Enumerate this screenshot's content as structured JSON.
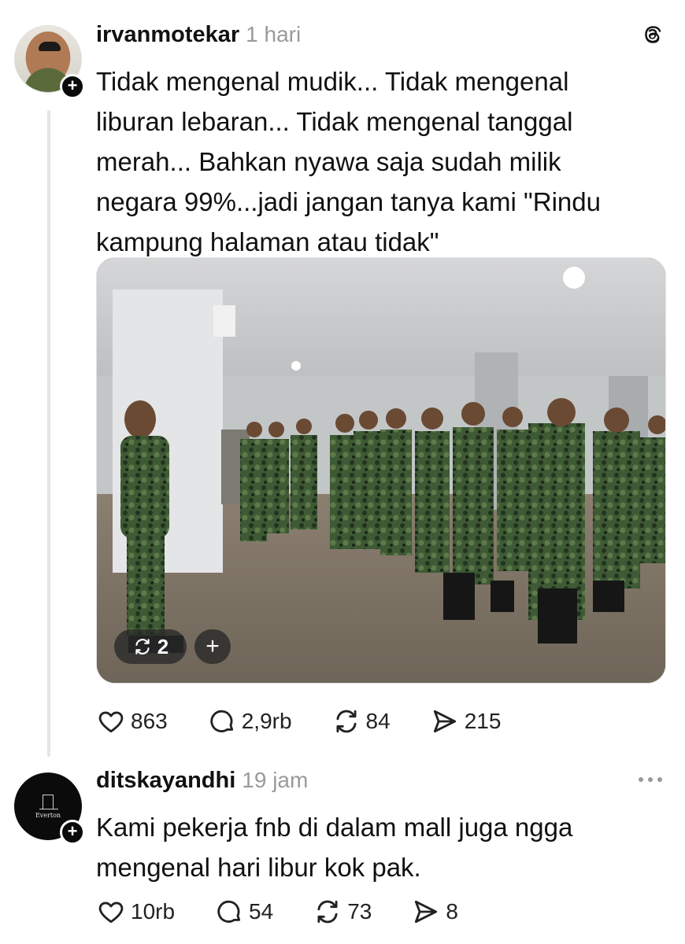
{
  "posts": [
    {
      "username": "irvanmotekar",
      "time": "1 hari",
      "text": "Tidak mengenal mudik... Tidak mengenal\nliburan lebaran... Tidak mengenal tanggal\nmerah... Bahkan nyawa saja sudah milik\nnegara 99%...jadi jangan tanya kami \"Rindu\nkampung halaman atau tidak\"",
      "image_overlay": {
        "repost_count": "2",
        "add_icon": "plus-icon"
      },
      "likes": "863",
      "replies": "2,9rb",
      "reposts": "84",
      "shares": "215"
    },
    {
      "username": "ditskayandhi",
      "time": "19 jam",
      "avatar_logo_text": "Everton",
      "text": "Kami pekerja fnb di dalam mall juga ngga\nmengenal hari libur kok pak.",
      "likes": "10rb",
      "replies": "54",
      "reposts": "73",
      "shares": "8"
    }
  ],
  "icons": {
    "app_logo": "threads-logo-icon",
    "more": "more-dots-icon",
    "like": "heart-icon",
    "reply": "comment-bubble-icon",
    "repost": "repost-icon",
    "share": "send-icon",
    "follow": "plus-icon"
  },
  "colors": {
    "text": "#111111",
    "muted": "#9a9a9a",
    "thread_line": "#e5e5e5",
    "badge": "#0a0a0a"
  }
}
